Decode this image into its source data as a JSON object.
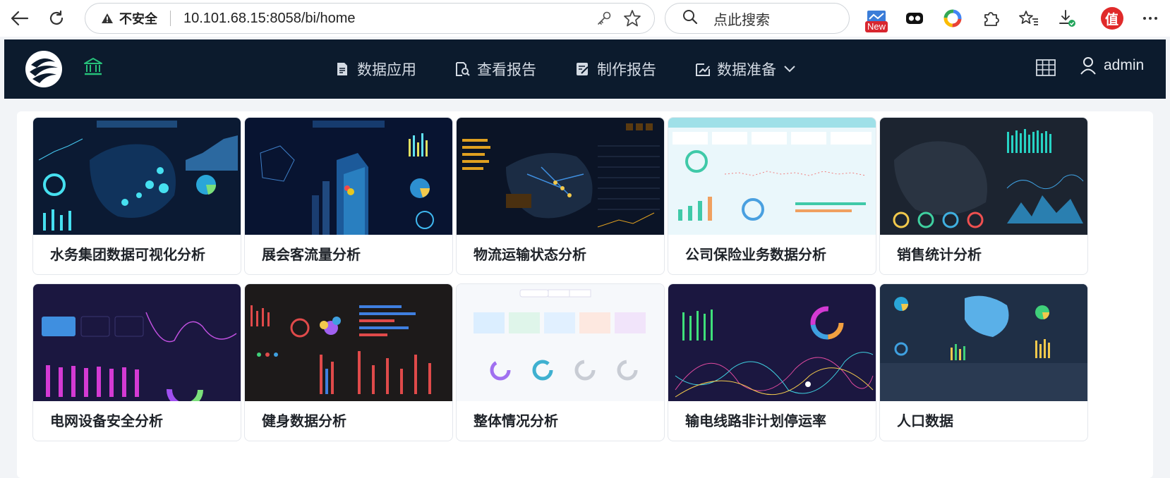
{
  "browser": {
    "insecure_label": "不安全",
    "url": "10.101.68.15:8058/bi/home",
    "search_placeholder": "点此搜索",
    "new_badge": "New",
    "ext_zhi": "值"
  },
  "header": {
    "nav": [
      {
        "label": "数据应用",
        "icon": "document-icon"
      },
      {
        "label": "查看报告",
        "icon": "report-search-icon"
      },
      {
        "label": "制作报告",
        "icon": "edit-report-icon"
      },
      {
        "label": "数据准备",
        "icon": "data-prep-icon"
      }
    ],
    "user": "admin"
  },
  "cards": [
    {
      "title": "水务集团数据可视化分析",
      "theme": "dark-map"
    },
    {
      "title": "展会客流量分析",
      "theme": "city"
    },
    {
      "title": "物流运输状态分析",
      "theme": "logistics"
    },
    {
      "title": "公司保险业务数据分析",
      "theme": "light-cyan"
    },
    {
      "title": "销售统计分析",
      "theme": "dark-coffee"
    },
    {
      "title": "电网设备安全分析",
      "theme": "purple-bars"
    },
    {
      "title": "健身数据分析",
      "theme": "fitness"
    },
    {
      "title": "整体情况分析",
      "theme": "light-gauges"
    },
    {
      "title": "输电线路非计划停运率",
      "theme": "purple-lines"
    },
    {
      "title": "人口数据",
      "theme": "slate-map"
    }
  ],
  "colors": {
    "header_bg": "#0c1b2d",
    "home_icon": "#26c07a",
    "page_bg": "#f2f4f7"
  }
}
